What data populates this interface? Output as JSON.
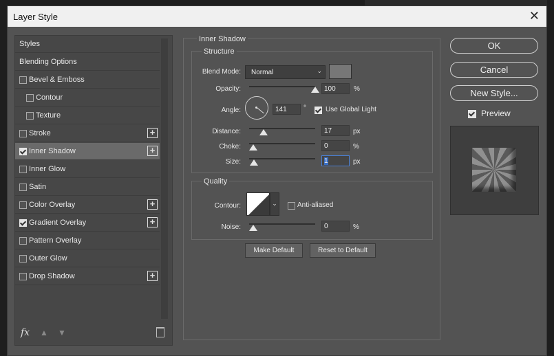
{
  "window": {
    "title": "Layer Style",
    "close_glyph": "✕"
  },
  "sidebar": {
    "items": [
      {
        "label": "Styles",
        "checkbox": false
      },
      {
        "label": "Blending Options",
        "checkbox": false
      },
      {
        "label": "Bevel & Emboss",
        "checkbox": true,
        "checked": false,
        "plus": false
      },
      {
        "label": "Contour",
        "checkbox": true,
        "checked": false,
        "plus": false
      },
      {
        "label": "Texture",
        "checkbox": true,
        "checked": false,
        "plus": false
      },
      {
        "label": "Stroke",
        "checkbox": true,
        "checked": false,
        "plus": true
      },
      {
        "label": "Inner Shadow",
        "checkbox": true,
        "checked": true,
        "plus": true
      },
      {
        "label": "Inner Glow",
        "checkbox": true,
        "checked": false,
        "plus": false
      },
      {
        "label": "Satin",
        "checkbox": true,
        "checked": false,
        "plus": false
      },
      {
        "label": "Color Overlay",
        "checkbox": true,
        "checked": false,
        "plus": true
      },
      {
        "label": "Gradient Overlay",
        "checkbox": true,
        "checked": true,
        "plus": true
      },
      {
        "label": "Pattern Overlay",
        "checkbox": true,
        "checked": false,
        "plus": false
      },
      {
        "label": "Outer Glow",
        "checkbox": true,
        "checked": false,
        "plus": false
      },
      {
        "label": "Drop Shadow",
        "checkbox": true,
        "checked": false,
        "plus": true
      }
    ],
    "selected": "Inner Shadow",
    "fx_label": "fx",
    "plus_glyph": "+",
    "up_glyph": "▲",
    "down_glyph": "▼"
  },
  "inner_shadow": {
    "title": "Inner Shadow",
    "structure_title": "Structure",
    "blend_mode": {
      "label": "Blend Mode:",
      "value": "Normal"
    },
    "shadow_color": "#777777",
    "opacity": {
      "label": "Opacity:",
      "value": "100",
      "unit": "%",
      "level": 100
    },
    "angle": {
      "label": "Angle:",
      "value": "141",
      "unit": "°",
      "degrees": 141
    },
    "use_global_light": {
      "label": "Use Global Light",
      "checked": true
    },
    "distance": {
      "label": "Distance:",
      "value": "17",
      "unit": "px",
      "level": 17
    },
    "choke": {
      "label": "Choke:",
      "value": "0",
      "unit": "%",
      "level": 0
    },
    "size": {
      "label": "Size:",
      "value": "1",
      "unit": "px",
      "level": 1
    },
    "quality_title": "Quality",
    "contour": {
      "label": "Contour:"
    },
    "anti_aliased": {
      "label": "Anti-aliased",
      "checked": false
    },
    "noise": {
      "label": "Noise:",
      "value": "0",
      "unit": "%",
      "level": 0
    },
    "make_default": "Make Default",
    "reset_default": "Reset to Default"
  },
  "actions": {
    "ok": "OK",
    "cancel": "Cancel",
    "new_style": "New Style...",
    "preview_label": "Preview",
    "preview_checked": true
  },
  "colors": {
    "dialog_bg": "#535353",
    "selected_item": "#6a6a6a",
    "focus_border": "#4a7fd4"
  }
}
